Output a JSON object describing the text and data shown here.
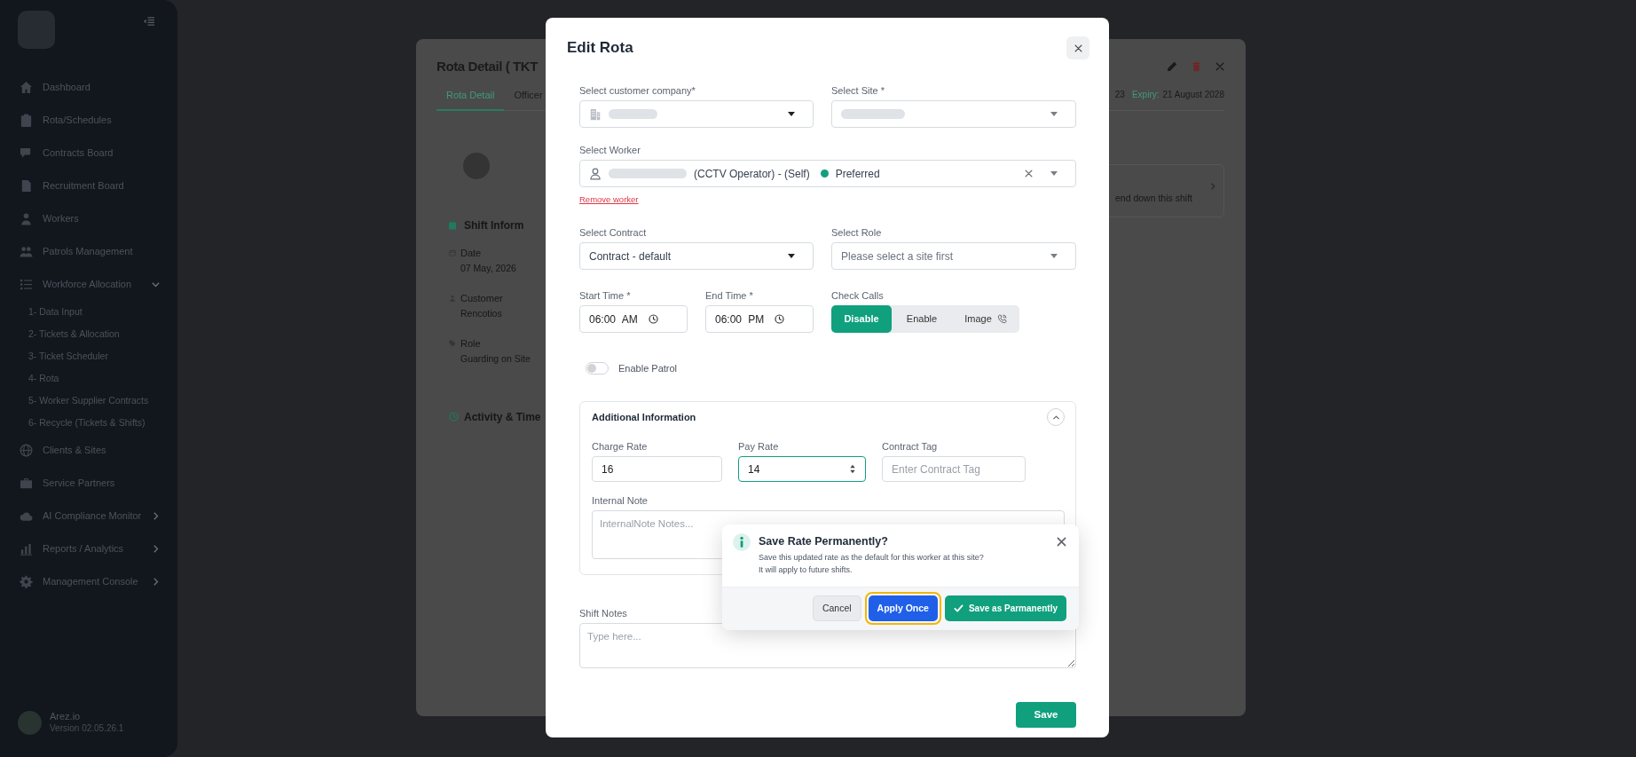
{
  "sidebar": {
    "items": [
      {
        "label": "Dashboard"
      },
      {
        "label": "Rota/Schedules"
      },
      {
        "label": "Contracts Board"
      },
      {
        "label": "Recruitment Board"
      },
      {
        "label": "Workers"
      },
      {
        "label": "Patrols Management"
      },
      {
        "label": "Workforce Allocation",
        "expanded": true,
        "children": [
          {
            "label": "1- Data Input"
          },
          {
            "label": "2- Tickets & Allocation"
          },
          {
            "label": "3- Ticket Scheduler"
          },
          {
            "label": "4- Rota"
          },
          {
            "label": "5- Worker Supplier Contracts"
          },
          {
            "label": "6- Recycle (Tickets & Shifts)"
          }
        ]
      },
      {
        "label": "Clients & Sites"
      },
      {
        "label": "Service Partners"
      },
      {
        "label": "AI Compliance Monitor",
        "expanded": false
      },
      {
        "label": "Reports / Analytics",
        "expanded": false
      },
      {
        "label": "Management Console",
        "expanded": false
      }
    ],
    "footer": {
      "name": "Arez.io",
      "version": "Version 02.05.26.1"
    }
  },
  "detail_page": {
    "title": "Rota Detail ( TKT",
    "tabs": [
      {
        "label": "Rota Detail",
        "selected": true
      },
      {
        "label": "Officer",
        "selected": false
      }
    ],
    "reference": "23",
    "expiry_label": "Expiry:",
    "expiry_date": "21 August 2028",
    "shift_info": {
      "title": "Shift Inform",
      "fields": [
        {
          "label": "Date",
          "value": "07 May, 2026"
        },
        {
          "label": "Customer",
          "value": "Rencotios"
        },
        {
          "label": "Role",
          "value": "Guarding on Site"
        }
      ]
    },
    "activity_title": "Activity & Time",
    "side_card": {
      "text": "end down this shift"
    }
  },
  "modal": {
    "title": "Edit Rota",
    "customer_company": {
      "label": "Select customer company*",
      "redacted": true
    },
    "site": {
      "label": "Select Site *",
      "redacted": true
    },
    "worker": {
      "label": "Select Worker",
      "redacted": true,
      "role": "(CCTV Operator) - (Self)",
      "status": "Preferred"
    },
    "remove_worker": "Remove worker",
    "contract": {
      "label": "Select Contract",
      "value": "Contract - default"
    },
    "role": {
      "label": "Select Role",
      "placeholder": "Please select a site first"
    },
    "start_time": {
      "label": "Start Time *",
      "value": "06:00 AM"
    },
    "end_time": {
      "label": "End Time *",
      "value": "06:00 PM"
    },
    "check_calls": {
      "label": "Check Calls",
      "options": [
        {
          "label": "Disable",
          "selected": true
        },
        {
          "label": "Enable",
          "selected": false
        },
        {
          "label": "Image",
          "selected": false
        }
      ]
    },
    "enable_patrol": {
      "label": "Enable Patrol",
      "on": false
    },
    "additional": {
      "title": "Additional Information",
      "expanded": true,
      "charge_rate": {
        "label": "Charge Rate",
        "value": "16"
      },
      "pay_rate": {
        "label": "Pay Rate",
        "value": "14",
        "focused": true
      },
      "contract_tag": {
        "label": "Contract Tag",
        "placeholder": "Enter Contract Tag"
      },
      "internal_note": {
        "label": "Internal Note",
        "placeholder": "InternalNote Notes..."
      }
    },
    "shift_notes": {
      "label": "Shift Notes",
      "placeholder": "Type here..."
    },
    "save": "Save"
  },
  "rate_popover": {
    "title": "Save Rate Permanently?",
    "message": "Save this updated rate as the default for this worker at this site?\nIt will apply to future shifts.",
    "buttons": [
      {
        "label": "Cancel",
        "kind": "secondary",
        "focused": false
      },
      {
        "label": "Apply Once",
        "kind": "primary",
        "focused": true
      },
      {
        "label": "Save as Parmanently",
        "kind": "success",
        "focused": false
      }
    ]
  }
}
